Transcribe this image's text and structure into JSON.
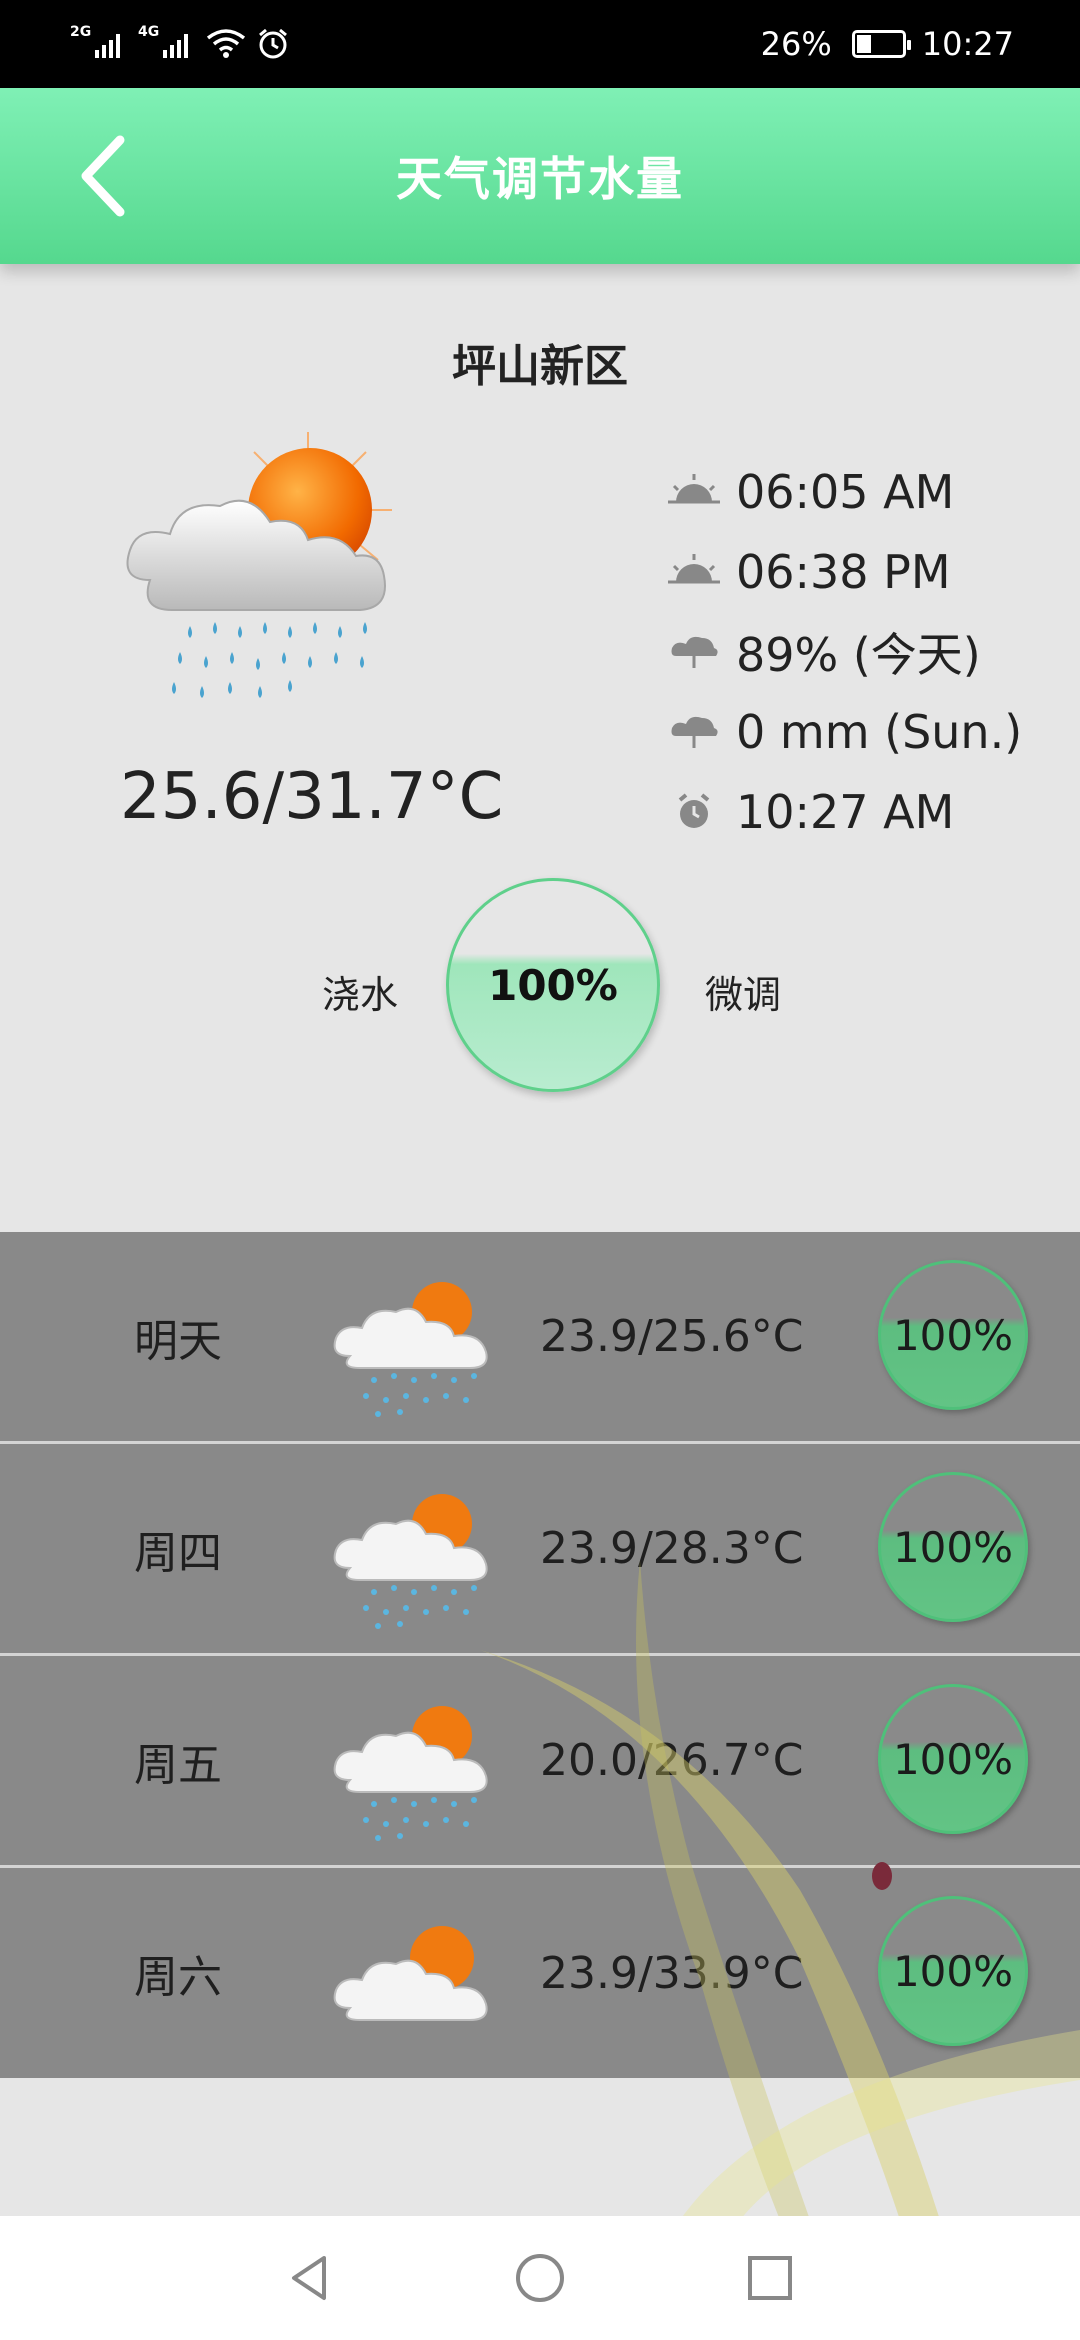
{
  "status_bar": {
    "signal1_tag": "2G",
    "signal2_tag": "4G",
    "battery_text": "26%",
    "time": "10:27"
  },
  "header": {
    "title": "天气调节水量",
    "back_icon": "chevron-left-icon"
  },
  "today": {
    "location": "坪山新区",
    "temperature": "25.6/31.7°C",
    "icon": "sun-cloud-rain-icon",
    "info": [
      {
        "icon": "sunrise-icon",
        "text": "06:05 AM"
      },
      {
        "icon": "sunset-icon",
        "text": "06:38 PM"
      },
      {
        "icon": "rain-cloud-icon",
        "text": "89% (今天)"
      },
      {
        "icon": "rain-cloud-icon",
        "text": "0 mm (Sun.)"
      },
      {
        "icon": "alarm-clock-icon",
        "text": "10:27 AM"
      }
    ],
    "water": {
      "left_label": "浇水",
      "value": "100%",
      "right_label": "微调"
    }
  },
  "forecast": [
    {
      "day": "明天",
      "temp": "23.9/25.6°C",
      "icon": "sun-cloud-rain-icon",
      "water": "100%"
    },
    {
      "day": "周四",
      "temp": "23.9/28.3°C",
      "icon": "sun-cloud-rain-icon",
      "water": "100%"
    },
    {
      "day": "周五",
      "temp": "20.0/26.7°C",
      "icon": "sun-cloud-rain-icon",
      "water": "100%"
    },
    {
      "day": "周六",
      "temp": "23.9/33.9°C",
      "icon": "sun-cloud-icon",
      "water": "100%"
    }
  ],
  "nav": {
    "back": "triangle-back-icon",
    "home": "circle-home-icon",
    "recents": "square-recents-icon"
  },
  "colors": {
    "header_top": "#7ff0b5",
    "header_bottom": "#55d88e",
    "gauge_border": "#5fd08b",
    "forecast_bg": "#898989"
  }
}
